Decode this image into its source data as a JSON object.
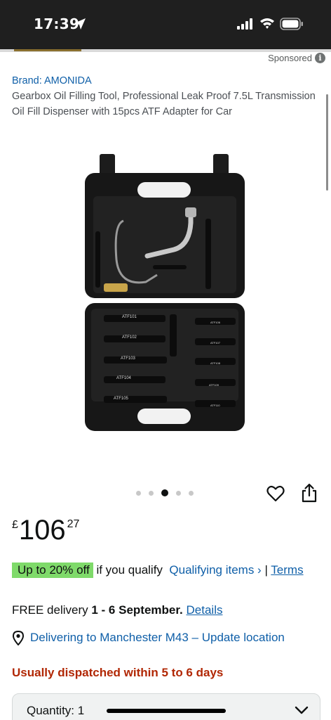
{
  "status_bar": {
    "time": "17:39"
  },
  "sponsored": {
    "label": "Sponsored",
    "icon": "info-icon"
  },
  "product": {
    "brand": "Brand: AMONIDA",
    "title": "Gearbox Oil Filling Tool, Professional Leak Proof 7.5L Transmission Oil Fill Dispenser with 15pcs ATF Adapter for Car",
    "image_labels": [
      "ATF101",
      "ATF102",
      "ATF103",
      "ATF104",
      "ATF105",
      "ATF106",
      "ATF107",
      "ATF108",
      "ATF109",
      "ATF110"
    ],
    "gallery": {
      "count": 5,
      "active_index": 2
    }
  },
  "price": {
    "symbol": "£",
    "whole": "106",
    "fraction": "27"
  },
  "promo": {
    "badge": "Up to 20% off",
    "text": "if you qualify",
    "link": "Qualifying items ›",
    "separator": "|",
    "terms": "Terms"
  },
  "delivery": {
    "prefix": "FREE delivery",
    "dates": "1 - 6 September",
    "suffix": ".",
    "details_link": "Details"
  },
  "location": {
    "text": "Delivering to Manchester M43 – Update location"
  },
  "dispatch": {
    "text": "Usually dispatched within 5 to 6 days"
  },
  "quantity": {
    "label": "Quantity:",
    "value": "1"
  },
  "colors": {
    "link": "#0f5fa8",
    "badge": "#7fda6a",
    "dispatch": "#b12704",
    "status_bar": "#1f1f1f"
  }
}
